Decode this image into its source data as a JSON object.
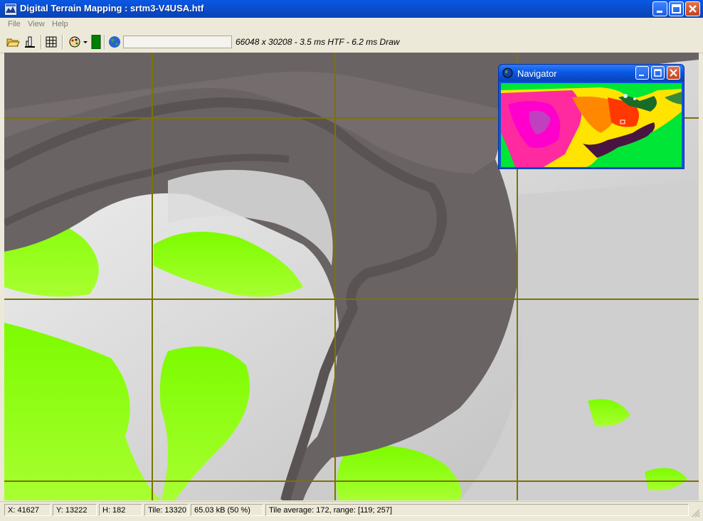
{
  "window": {
    "title": "Digital Terrain Mapping : srtm3-V4USA.htf"
  },
  "menu": {
    "items": [
      {
        "label": "File"
      },
      {
        "label": "View"
      },
      {
        "label": "Help"
      }
    ]
  },
  "toolbar": {
    "buttons": [
      "open-folder-icon",
      "terrain-profile-icon",
      "grid-icon",
      "palette-icon",
      "color-swatch-icon",
      "globe-icon"
    ],
    "swatch_color": "#008000",
    "progress_fraction": 0.0,
    "perf_text": "66048 x 30208 - 3.5 ms HTF - 6.2 ms Draw"
  },
  "navigator": {
    "title": "Navigator"
  },
  "status": {
    "x": "X: 41627",
    "y": "Y: 13222",
    "h": "H: 182",
    "tile": "Tile: 13320",
    "memory": "65.03 kB (50 %)",
    "tile_stats": "Tile average: 172, range: [119; 257]"
  },
  "colors": {
    "titlebar": "#0a4fd0",
    "lowland_green": "#7cfc00",
    "water_gray": "#6a6364",
    "grid_line": "#7a7400"
  }
}
